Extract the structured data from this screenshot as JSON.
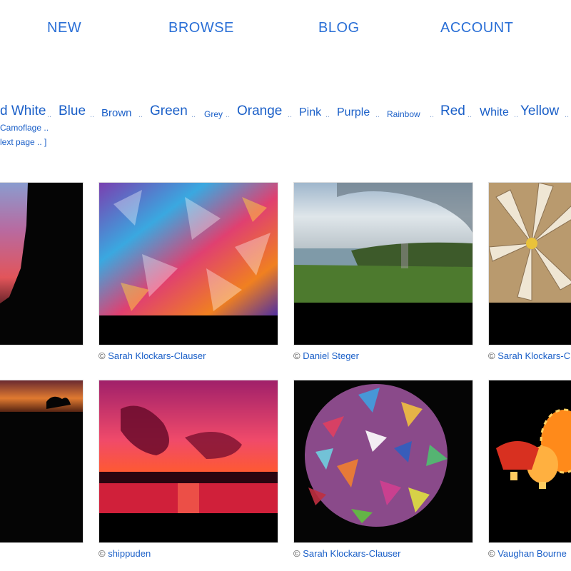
{
  "nav": {
    "items": [
      {
        "label": "NEW"
      },
      {
        "label": "BROWSE"
      },
      {
        "label": "BLOG"
      },
      {
        "label": "ACCOUNT"
      }
    ]
  },
  "colors": {
    "tags": [
      {
        "label": "d White"
      },
      {
        "label": "Blue"
      },
      {
        "label": "Brown"
      },
      {
        "label": "Green"
      },
      {
        "label": "Grey"
      },
      {
        "label": "Orange"
      },
      {
        "label": "Pink"
      },
      {
        "label": "Purple"
      },
      {
        "label": "Rainbow"
      },
      {
        "label": "Red"
      },
      {
        "label": "White"
      },
      {
        "label": "Yellow"
      }
    ],
    "separator": "..",
    "extra_line": "Camoflage ..",
    "pagination": "lext page .. ]"
  },
  "gallery": {
    "copyright_symbol": "©",
    "items": [
      {
        "credit": ""
      },
      {
        "credit": "Sarah Klockars-Clauser"
      },
      {
        "credit": "Daniel Steger"
      },
      {
        "credit": "Sarah Klockars-Clauser"
      },
      {
        "credit": ""
      },
      {
        "credit": "shippuden"
      },
      {
        "credit": "Sarah Klockars-Clauser"
      },
      {
        "credit": "Vaughan Bourne"
      }
    ]
  },
  "theme": {
    "link_color": "#1a5fc8"
  }
}
